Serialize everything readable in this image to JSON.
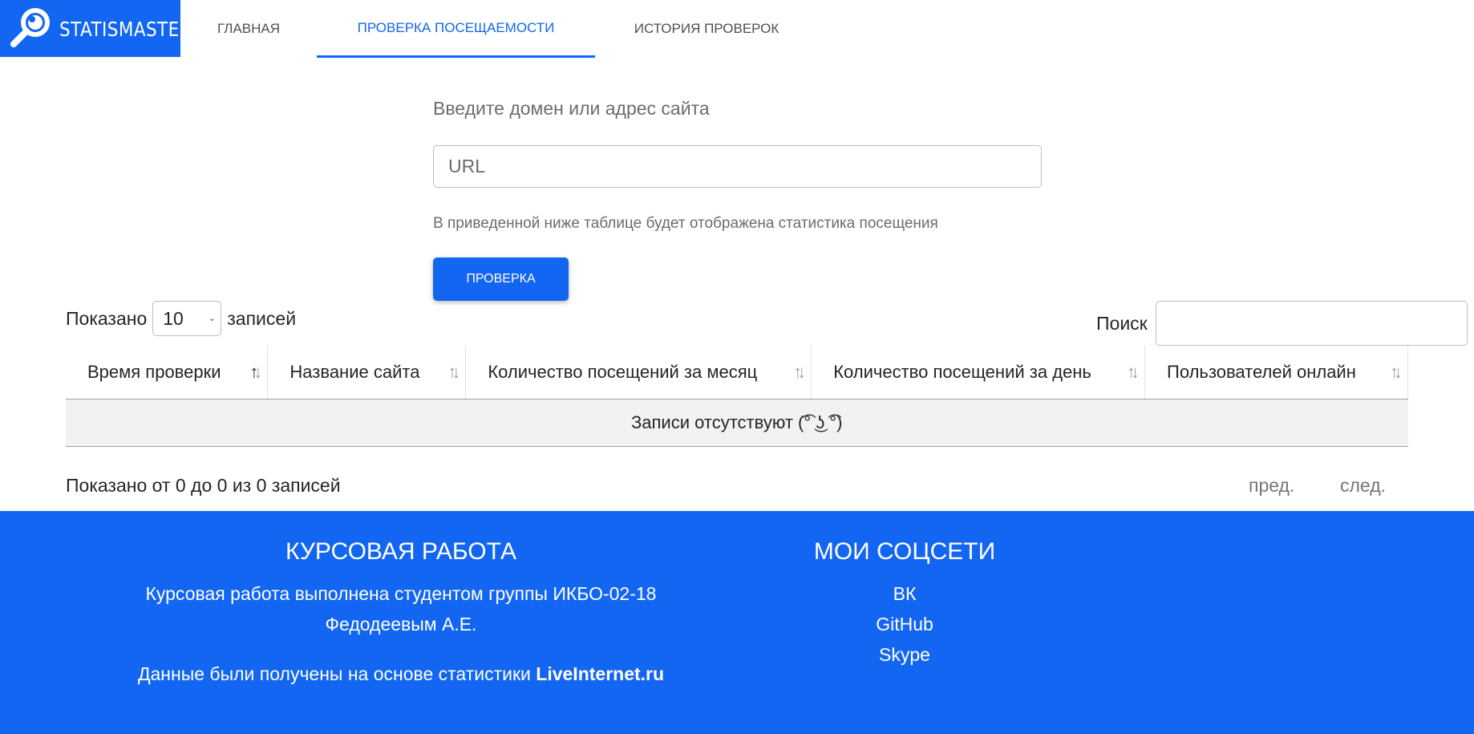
{
  "navbar": {
    "brand": "STATISMASTER",
    "items": [
      {
        "label": "ГЛАВНАЯ"
      },
      {
        "label": "ПРОВЕРКА ПОСЕЩАЕМОСТИ",
        "active": true
      },
      {
        "label": "ИСТОРИЯ ПРОВЕРОК"
      }
    ]
  },
  "form": {
    "label": "Введите домен или адрес сайта",
    "url_placeholder": "URL",
    "url_value": "",
    "help": "В приведенной ниже таблице будет отображена статистика посещения",
    "submit_label": "ПРОВЕРКА"
  },
  "table": {
    "length_prefix": "Показано",
    "length_value": "10",
    "length_suffix": "записей",
    "search_label": "Поиск",
    "search_value": "",
    "columns": [
      "Время проверки",
      "Название сайта",
      "Количество посещений за месяц",
      "Количество посещений за день",
      "Пользователей онлайн"
    ],
    "empty_text": "Записи отсутствуют (͡° ͜ʖ ͡°)",
    "info": "Показано от 0 до 0 из 0 записей",
    "prev_label": "пред.",
    "next_label": "след."
  },
  "footer": {
    "course_title": "КУРСОВАЯ РАБОТА",
    "course_line1": "Курсовая работа выполнена студентом группы ИКБО-02-18",
    "course_line2": "Федодеевым А.Е.",
    "source_prefix": "Данные были получены на основе статистики ",
    "source_name": "LiveInternet.ru",
    "social_title": "МОИ СОЦСЕТИ",
    "social_links": [
      "ВК",
      "GitHub",
      "Skype"
    ]
  },
  "colors": {
    "primary": "#1266f1",
    "nav_text": "#4f4f4f",
    "muted_text": "#6c6c6c",
    "empty_row_bg": "#f2f2f2"
  }
}
